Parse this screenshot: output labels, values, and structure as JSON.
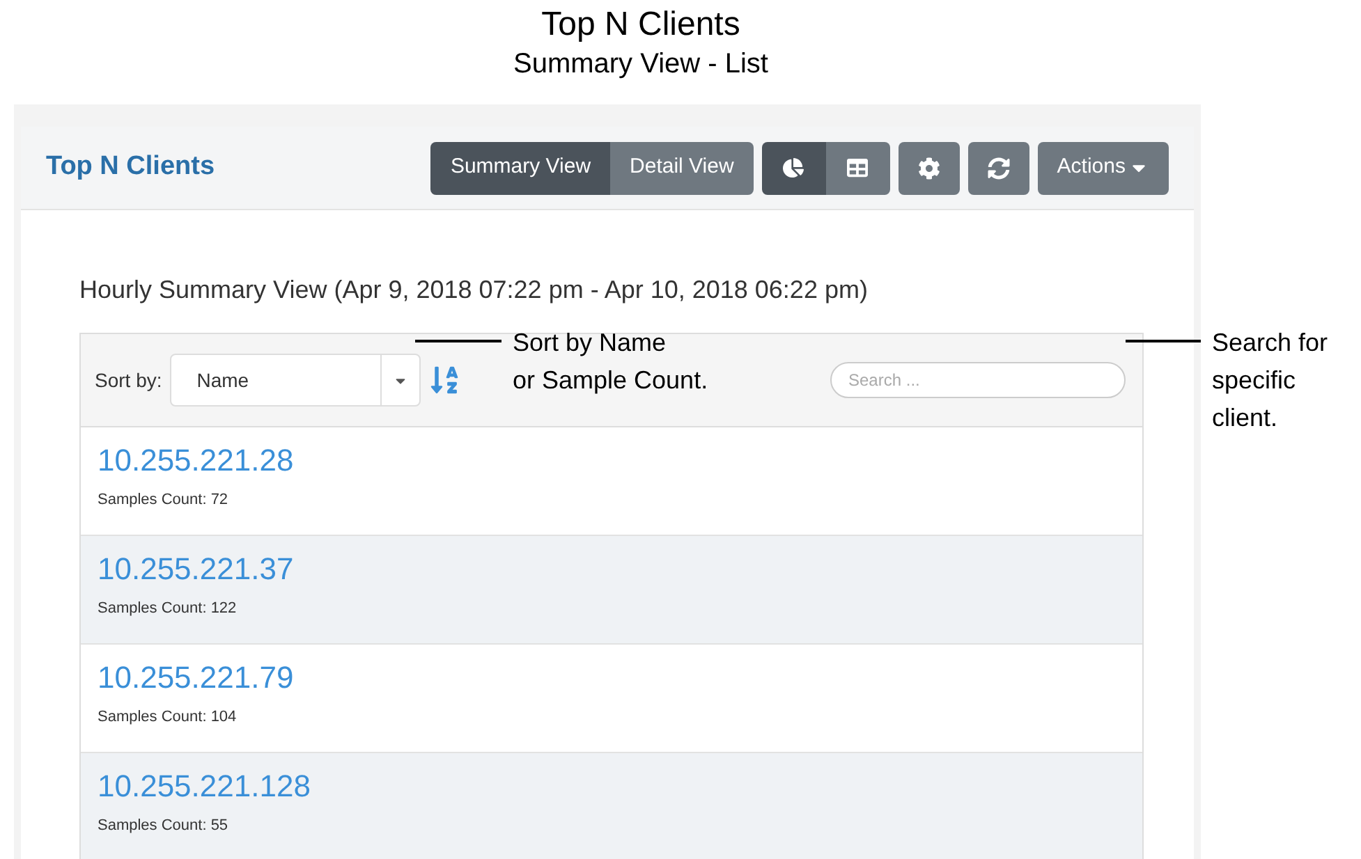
{
  "figure_title": "Top N Clients",
  "figure_subtitle": "Summary View - List",
  "panel": {
    "title": "Top N Clients",
    "view_tabs": [
      {
        "label": "Summary View",
        "selected": true
      },
      {
        "label": "Detail View",
        "selected": false
      }
    ],
    "display_toggles": [
      {
        "kind": "pie",
        "selected": true
      },
      {
        "kind": "table",
        "selected": false
      }
    ],
    "actions_label": "Actions"
  },
  "summary_heading": "Hourly Summary View (Apr 9, 2018 07:22 pm - Apr 10, 2018 06:22 pm)",
  "sort": {
    "label": "Sort by:",
    "value": "Name"
  },
  "search": {
    "placeholder": "Search ..."
  },
  "clients": [
    {
      "address": "10.255.221.28",
      "count": "Samples Count: 72"
    },
    {
      "address": "10.255.221.37",
      "count": "Samples Count: 122"
    },
    {
      "address": "10.255.221.79",
      "count": "Samples Count: 104"
    },
    {
      "address": "10.255.221.128",
      "count": "Samples Count: 55"
    }
  ],
  "callouts": [
    {
      "kind": "sort",
      "lines": [
        "Sort by Name",
        "or Sample Count."
      ]
    },
    {
      "kind": "search",
      "lines": [
        "Search for",
        "specific",
        "client."
      ]
    }
  ]
}
